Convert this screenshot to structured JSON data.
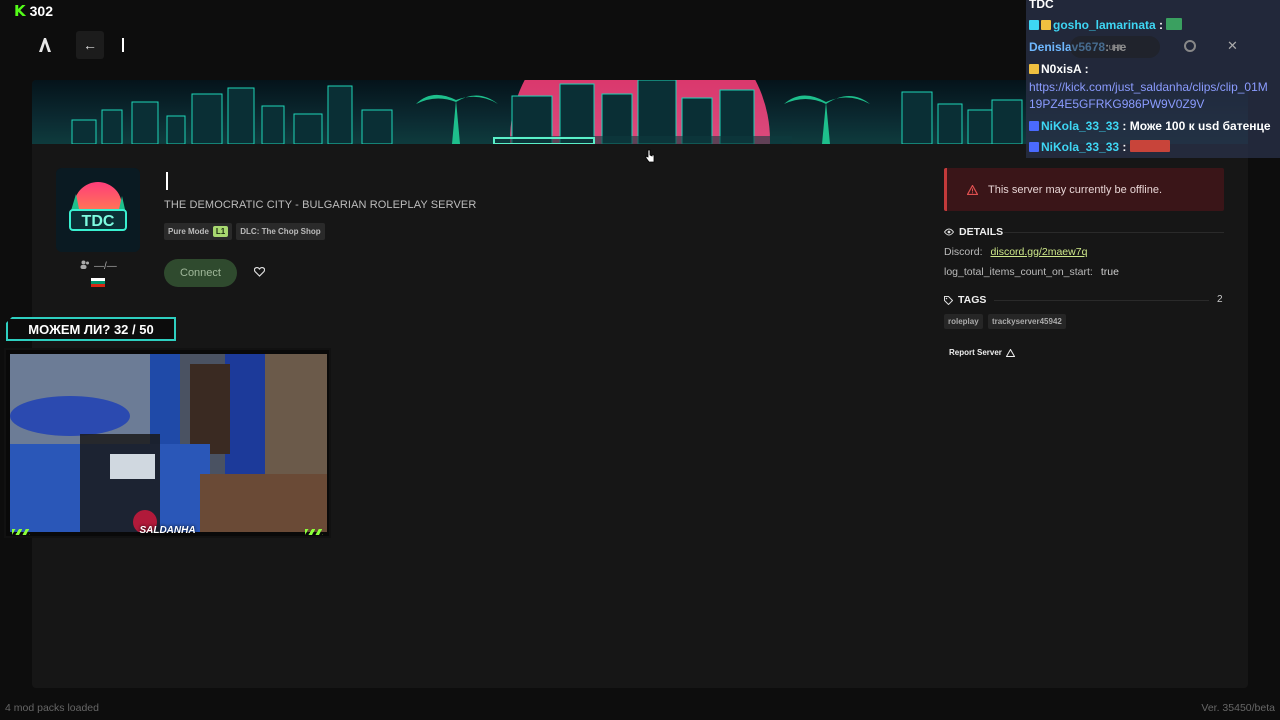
{
  "stream": {
    "viewer_count": "302",
    "goal_text": "МОЖЕМ ЛИ? 32 / 50",
    "streamer_name": "SALDANHA"
  },
  "nav": {
    "back_icon": "arrow-left-icon"
  },
  "server": {
    "subtitle": "THE DEMOCRATIC CITY - BULGARIAN ROLEPLAY SERVER",
    "icon_text": "TDC",
    "players": "—/—",
    "chips": [
      {
        "label": "Pure Mode",
        "level": "L1"
      },
      {
        "label": "DLC: The Chop Shop"
      }
    ],
    "connect_label": "Connect",
    "offline_message": "This server may currently be offline.",
    "details_title": "DETAILS",
    "details": [
      {
        "key": "Discord:",
        "value": "discord.gg/2maew7q"
      },
      {
        "key": "log_total_items_count_on_start:",
        "value": "true"
      }
    ],
    "tags_title": "TAGS",
    "tags_count": "2",
    "tags": [
      "roleplay",
      "trackyserver45942"
    ],
    "report_label": "Report Server"
  },
  "chat": {
    "header": "TDC",
    "lines": [
      {
        "user": "gosho_lamarinata",
        "text": ":"
      },
      {
        "user": "Denislav5678",
        "text": ": не"
      },
      {
        "user": "N0xisA",
        "text": ":"
      },
      {
        "text": "https://kick.com/just_saldanha/clips/clip_01M"
      },
      {
        "text": "19PZ4E5GFRKG986PW9V0Z9V"
      },
      {
        "user": "NiKola_33_33",
        "text": ": Може 100 к usd батенце"
      },
      {
        "user": "NiKola_33_33",
        "text": ":"
      }
    ],
    "controls_label": "unt"
  },
  "footer": {
    "mods": "4 mod packs loaded",
    "version": "Ver. 35450/beta"
  },
  "colors": {
    "accent_green": "#53fc18",
    "offline_red": "#c23a3a",
    "link_green": "#cfe98a"
  }
}
